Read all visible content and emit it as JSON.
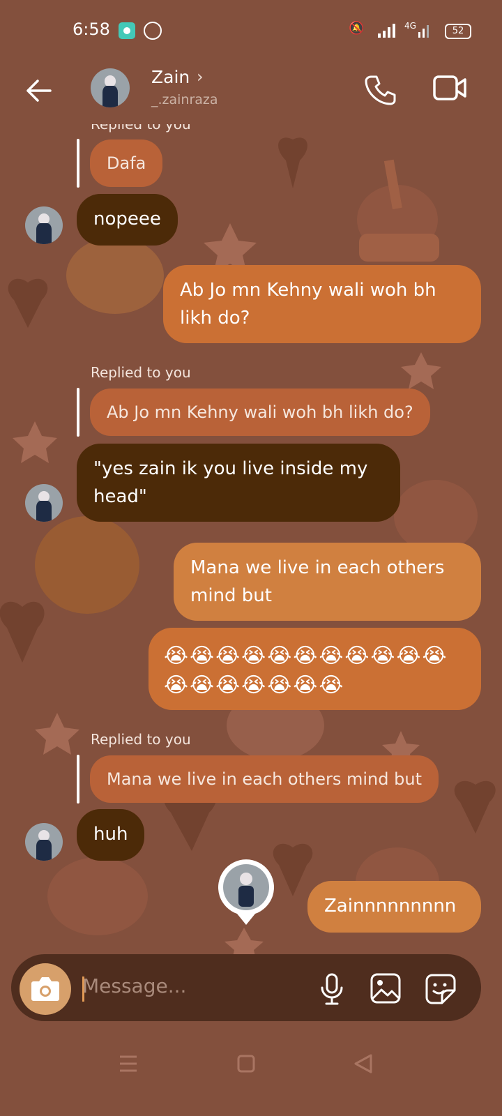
{
  "status_bar": {
    "time": "6:58",
    "network": "4G",
    "battery": "52"
  },
  "header": {
    "name": "Zain",
    "username": "_.zainraza"
  },
  "messages": [
    {
      "type": "reply",
      "label": "Replied to you",
      "quote": "Dafa"
    },
    {
      "type": "incoming",
      "text": "nopeee"
    },
    {
      "type": "outgoing",
      "text": "Ab Jo mn Kehny wali woh bh likh do?"
    },
    {
      "type": "reply",
      "label": "Replied to you",
      "quote": "Ab Jo mn Kehny wali woh bh likh do?"
    },
    {
      "type": "incoming",
      "text": "\"yes zain ik you live inside my head\""
    },
    {
      "type": "outgoing",
      "text": "Mana we live in each others mind but"
    },
    {
      "type": "outgoing",
      "text": "😭😭😭😭😭😭😭😭😭😭😭😭😭😭😭😭😭😭"
    },
    {
      "type": "reply",
      "label": "Replied to you",
      "quote": "Mana we live in each others mind but"
    },
    {
      "type": "incoming",
      "text": "huh"
    },
    {
      "type": "outgoing",
      "text": "Zainnnnnnnnn"
    }
  ],
  "composer": {
    "placeholder": "Message..."
  },
  "icons": {
    "back": "back-arrow-icon",
    "call": "phone-icon",
    "video": "video-camera-icon",
    "camera": "camera-icon",
    "mic": "microphone-icon",
    "gallery": "gallery-icon",
    "sticker": "sticker-icon"
  },
  "colors": {
    "background": "#83503d",
    "incoming": "#4c2a08",
    "outgoing": "#cb7034",
    "reply_quote": "#b96238",
    "composer": "#4f2d1e",
    "camera_button": "#d7a06b"
  }
}
